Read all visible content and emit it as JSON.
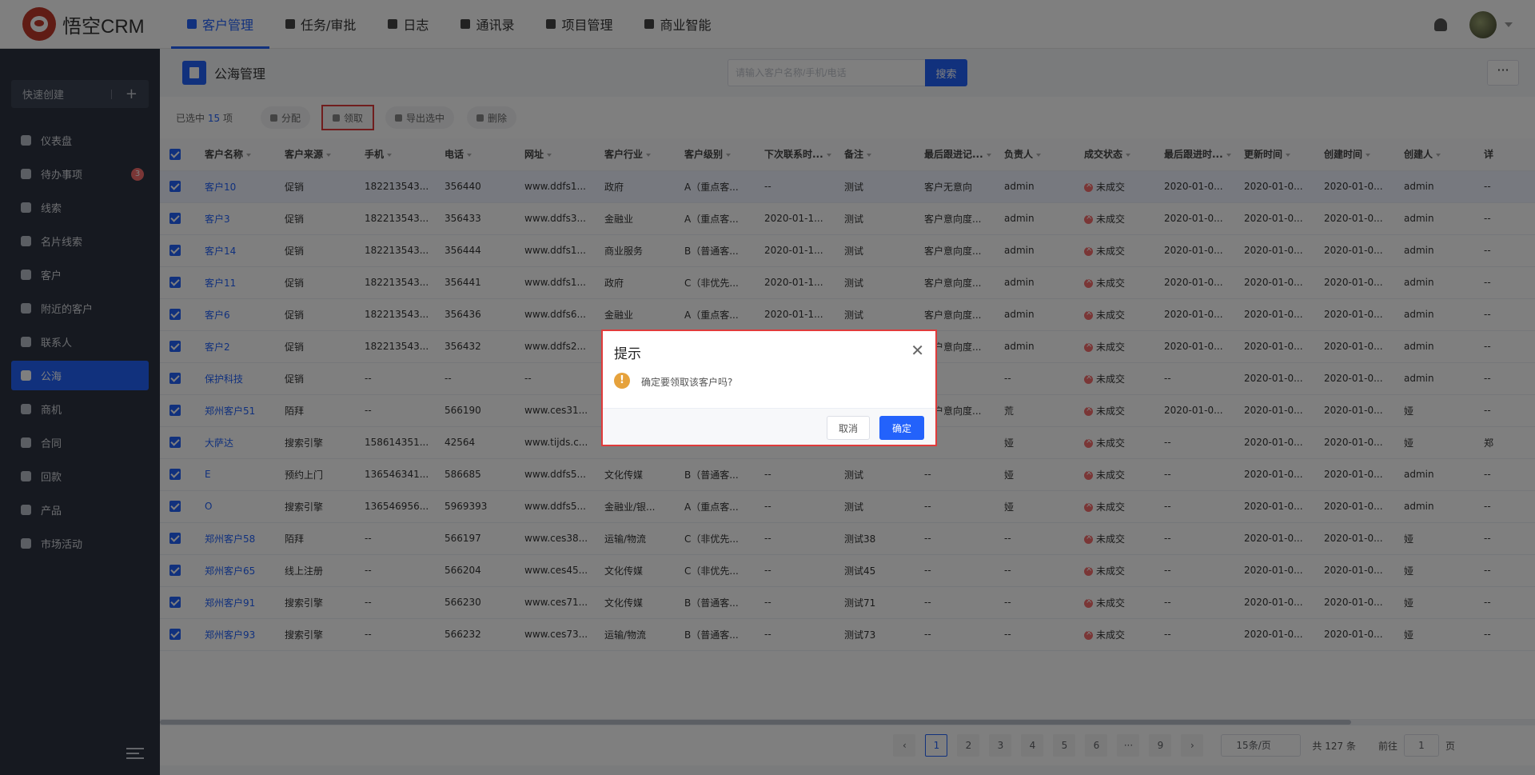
{
  "app": {
    "logo_text": "悟空CRM"
  },
  "topnav": {
    "items": [
      {
        "label": "客户管理",
        "icon": "building-icon"
      },
      {
        "label": "任务/审批",
        "icon": "briefcase-icon"
      },
      {
        "label": "日志",
        "icon": "notebook-icon"
      },
      {
        "label": "通讯录",
        "icon": "phone-book-icon"
      },
      {
        "label": "项目管理",
        "icon": "list-icon"
      },
      {
        "label": "商业智能",
        "icon": "shield-icon"
      }
    ],
    "active_index": 0
  },
  "sidebar": {
    "quick_create": "快速创建",
    "items": [
      {
        "label": "仪表盘"
      },
      {
        "label": "待办事项",
        "badge": "3"
      },
      {
        "label": "线索"
      },
      {
        "label": "名片线索"
      },
      {
        "label": "客户"
      },
      {
        "label": "附近的客户"
      },
      {
        "label": "联系人"
      },
      {
        "label": "公海"
      },
      {
        "label": "商机"
      },
      {
        "label": "合同"
      },
      {
        "label": "回款"
      },
      {
        "label": "产品"
      },
      {
        "label": "市场活动"
      }
    ],
    "active_index": 7
  },
  "page": {
    "title": "公海管理",
    "search_placeholder": "请输入客户名称/手机/电话",
    "search_button": "搜索",
    "more_button": "···"
  },
  "toolbar": {
    "selected_prefix": "已选中",
    "selected_count": "15",
    "selected_suffix": "项",
    "buttons": [
      "分配",
      "领取",
      "导出选中",
      "删除"
    ]
  },
  "table": {
    "columns": [
      "客户名称",
      "客户来源",
      "手机",
      "电话",
      "网址",
      "客户行业",
      "客户级别",
      "下次联系时...",
      "备注",
      "最后跟进记...",
      "负责人",
      "成交状态",
      "最后跟进时...",
      "更新时间",
      "创建时间",
      "创建人",
      "详"
    ],
    "rows": [
      [
        "客户10",
        "促销",
        "182213543...",
        "356440",
        "www.ddfs1...",
        "政府",
        "A（重点客...",
        "--",
        "测试",
        "客户无意向",
        "admin",
        "未成交",
        "2020-01-0...",
        "2020-01-0...",
        "2020-01-0...",
        "admin",
        "--"
      ],
      [
        "客户3",
        "促销",
        "182213543...",
        "356433",
        "www.ddfs3...",
        "金融业",
        "A（重点客...",
        "2020-01-1...",
        "测试",
        "客户意向度...",
        "admin",
        "未成交",
        "2020-01-0...",
        "2020-01-0...",
        "2020-01-0...",
        "admin",
        "--"
      ],
      [
        "客户14",
        "促销",
        "182213543...",
        "356444",
        "www.ddfs1...",
        "商业服务",
        "B（普通客...",
        "2020-01-1...",
        "测试",
        "客户意向度...",
        "admin",
        "未成交",
        "2020-01-0...",
        "2020-01-0...",
        "2020-01-0...",
        "admin",
        "--"
      ],
      [
        "客户11",
        "促销",
        "182213543...",
        "356441",
        "www.ddfs1...",
        "政府",
        "C（非优先...",
        "2020-01-1...",
        "测试",
        "客户意向度...",
        "admin",
        "未成交",
        "2020-01-0...",
        "2020-01-0...",
        "2020-01-0...",
        "admin",
        "--"
      ],
      [
        "客户6",
        "促销",
        "182213543...",
        "356436",
        "www.ddfs6...",
        "金融业",
        "A（重点客...",
        "2020-01-1...",
        "测试",
        "客户意向度...",
        "admin",
        "未成交",
        "2020-01-0...",
        "2020-01-0...",
        "2020-01-0...",
        "admin",
        "--"
      ],
      [
        "客户2",
        "促销",
        "182213543...",
        "356432",
        "www.ddfs2...",
        "",
        "",
        "",
        "",
        "客户意向度...",
        "admin",
        "未成交",
        "2020-01-0...",
        "2020-01-0...",
        "2020-01-0...",
        "admin",
        "--"
      ],
      [
        "保护科技",
        "促销",
        "--",
        "--",
        "--",
        "",
        "",
        "",
        "",
        "",
        "--",
        "未成交",
        "--",
        "2020-01-0...",
        "2020-01-0...",
        "admin",
        "--"
      ],
      [
        "郑州客户51",
        "陌拜",
        "--",
        "566190",
        "www.ces31...",
        "",
        "",
        "",
        "",
        "客户意向度...",
        "荒",
        "未成交",
        "2020-01-0...",
        "2020-01-0...",
        "2020-01-0...",
        "娅",
        "--"
      ],
      [
        "大萨达",
        "搜索引擎",
        "158614351...",
        "42564",
        "www.tijds.c...",
        "",
        "",
        "",
        "",
        "",
        "娅",
        "未成交",
        "--",
        "2020-01-0...",
        "2020-01-0...",
        "娅",
        "郑"
      ],
      [
        "E",
        "预约上门",
        "136546341...",
        "586685",
        "www.ddfs5...",
        "文化传媒",
        "B（普通客...",
        "--",
        "测试",
        "--",
        "娅",
        "未成交",
        "--",
        "2020-01-0...",
        "2020-01-0...",
        "admin",
        "--"
      ],
      [
        "O",
        "搜索引擎",
        "136546956...",
        "5969393",
        "www.ddfs5...",
        "金融业/银...",
        "A（重点客...",
        "--",
        "测试",
        "--",
        "娅",
        "未成交",
        "--",
        "2020-01-0...",
        "2020-01-0...",
        "admin",
        "--"
      ],
      [
        "郑州客户58",
        "陌拜",
        "--",
        "566197",
        "www.ces38...",
        "运输/物流",
        "C（非优先...",
        "--",
        "测试38",
        "--",
        "--",
        "未成交",
        "--",
        "2020-01-0...",
        "2020-01-0...",
        "娅",
        "--"
      ],
      [
        "郑州客户65",
        "线上注册",
        "--",
        "566204",
        "www.ces45...",
        "文化传媒",
        "C（非优先...",
        "--",
        "测试45",
        "--",
        "--",
        "未成交",
        "--",
        "2020-01-0...",
        "2020-01-0...",
        "娅",
        "--"
      ],
      [
        "郑州客户91",
        "搜索引擎",
        "--",
        "566230",
        "www.ces71...",
        "文化传媒",
        "B（普通客...",
        "--",
        "测试71",
        "--",
        "--",
        "未成交",
        "--",
        "2020-01-0...",
        "2020-01-0...",
        "娅",
        "--"
      ],
      [
        "郑州客户93",
        "搜索引擎",
        "--",
        "566232",
        "www.ces73...",
        "运输/物流",
        "B（普通客...",
        "--",
        "测试73",
        "--",
        "--",
        "未成交",
        "--",
        "2020-01-0...",
        "2020-01-0...",
        "娅",
        "--"
      ]
    ]
  },
  "pagination": {
    "pages": [
      "1",
      "2",
      "3",
      "4",
      "5",
      "6",
      "···",
      "9"
    ],
    "active_page": "1",
    "prev": "‹",
    "next": "›",
    "page_size": "15条/页",
    "total": "共 127 条",
    "goto_prefix": "前往",
    "goto_value": "1",
    "goto_suffix": "页"
  },
  "dialog": {
    "title": "提示",
    "message": "确定要领取该客户吗?",
    "cancel": "取消",
    "confirm": "确定",
    "warning_icon": "!",
    "close_icon": "✕"
  },
  "colors": {
    "accent": "#2362fb",
    "sidebar_bg": "#2c3340",
    "danger": "#f56c6c",
    "warning": "#e6a23c"
  }
}
